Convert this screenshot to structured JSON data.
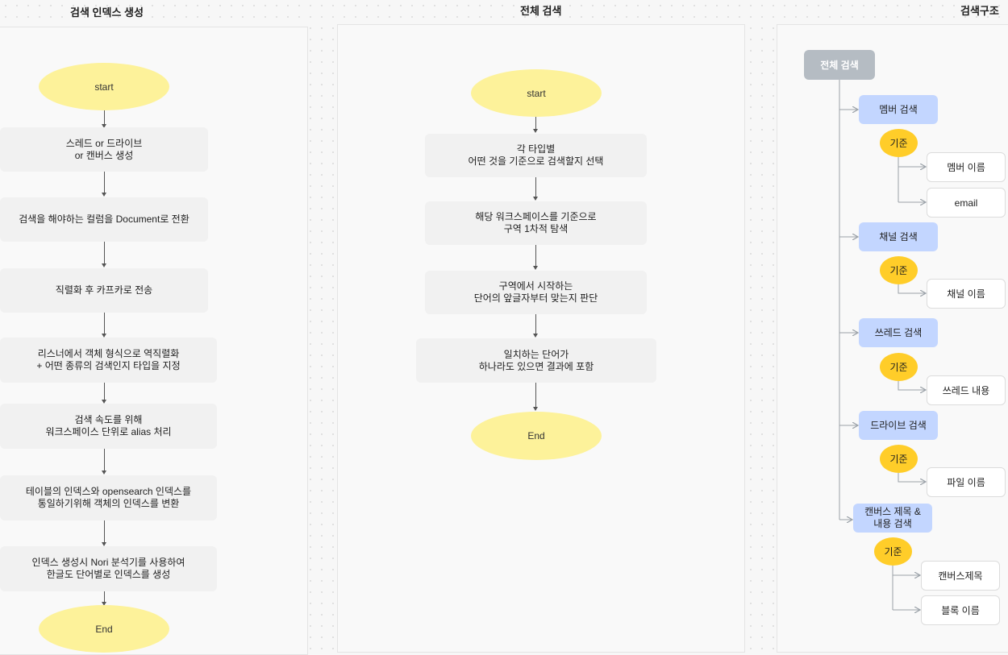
{
  "sections": {
    "index_title": "검색 인덱스 생성",
    "search_title": "전체 검색",
    "structure_title": "검색구조"
  },
  "index_flow": {
    "start": "start",
    "steps": [
      "스레드 or 드라이브\nor 캔버스 생성",
      "검색을 해야하는 컬럼을 Document로 전환",
      "직렬화 후 카프카로 전송",
      "리스너에서 객체 형식으로 역직렬화\n+ 어떤 종류의 검색인지 타입을 지정",
      "검색 속도를 위해\n워크스페이스 단위로 alias 처리",
      "테이블의 인덱스와 opensearch 인덱스를\n통일하기위해 객체의 인덱스를 변환",
      "인덱스 생성시 Nori 분석기를 사용하여\n한글도 단어별로 인덱스를 생성"
    ],
    "end": "End"
  },
  "search_flow": {
    "start": "start",
    "steps": [
      "각 타입별\n어떤 것을 기준으로 검색할지 선택",
      "해당 워크스페이스를 기준으로\n구역 1차적 탐색",
      "구역에서 시작하는\n단어의 앞글자부터 맞는지 판단",
      "일치하는 단어가\n하나라도 있으면 결과에 포함"
    ],
    "end": "End"
  },
  "structure": {
    "root": "전체 검색",
    "criteria_label": "기준",
    "categories": [
      {
        "label": "멤버 검색",
        "leaves": [
          "멤버 이름",
          "email"
        ]
      },
      {
        "label": "채널 검색",
        "leaves": [
          "채널 이름"
        ]
      },
      {
        "label": "쓰레드 검색",
        "leaves": [
          "쓰레드 내용"
        ]
      },
      {
        "label": "드라이브 검색",
        "leaves": [
          "파일 이름"
        ]
      },
      {
        "label": "캔버스 제목 &\n내용 검색",
        "leaves": [
          "캔버스제목",
          "블록 이름"
        ]
      }
    ]
  },
  "colors": {
    "terminal": "#fdf29a",
    "process": "#f1f1f1",
    "root": "#b5bcc3",
    "category": "#c3d6ff",
    "criteria": "#ffcd29",
    "leaf": "#ffffff"
  }
}
